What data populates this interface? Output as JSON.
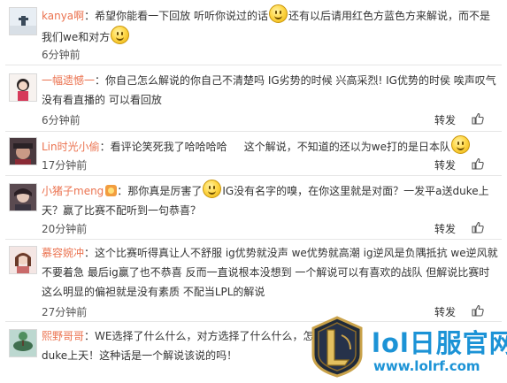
{
  "actions": {
    "forward_label": "转发",
    "like_icon": "thumbs-up-icon"
  },
  "comments": [
    {
      "username": "kanya啊",
      "colon": "：",
      "segments": [
        "希望你能看一下回放 听听你说过的话",
        "还有以后请用红色方蓝色方来解说，而不是我们we和对方",
        ""
      ],
      "time": "6分钟前"
    },
    {
      "username": "一幅遗憾一",
      "colon": "：",
      "segments": [
        "你自己怎么解说的你自己不清楚吗 IG劣势的时候 兴高采烈! IG优势的时侯 唉声叹气 没有看直播的 可以看回放"
      ],
      "time": "6分钟前"
    },
    {
      "username": "Lin时光小偷",
      "colon": "：",
      "segments": [
        "看评论笑死我了哈哈哈哈",
        "这个解说，不知道的还以为we打的是日本队"
      ],
      "time": "17分钟前"
    },
    {
      "username": "小猪子meng",
      "colon": "：",
      "segments": [
        "那你真是厉害了",
        "IG没有名字的嗅，在你这里就是对面？一发平a送duke上天？赢了比赛不配听到一句恭喜？"
      ],
      "time": "20分钟前"
    },
    {
      "username": "慕容婉冲",
      "colon": "：",
      "segments": [
        "这个比赛听得真让人不舒服 ig优势就没声 we优势就高潮 ig逆风是负隅抵抗 we逆风就不要着急 最后ig赢了也不恭喜 反而一直说根本没想到 一个解说可以有喜欢的战队 但解说比赛时这么明显的偏袒就是没有素质 不配当LPL的解说"
      ],
      "time": "27分钟前"
    },
    {
      "username": "熙野哥哥",
      "colon": "：",
      "segments": [
        "WE选择了什么什么，对方选择了什么什么，怎么",
        "duke上天！这种话是一个解说该说的吗！"
      ],
      "time": ""
    }
  ],
  "watermark": {
    "site_name": "lol日服官网",
    "url": "www.lolrf.com"
  }
}
